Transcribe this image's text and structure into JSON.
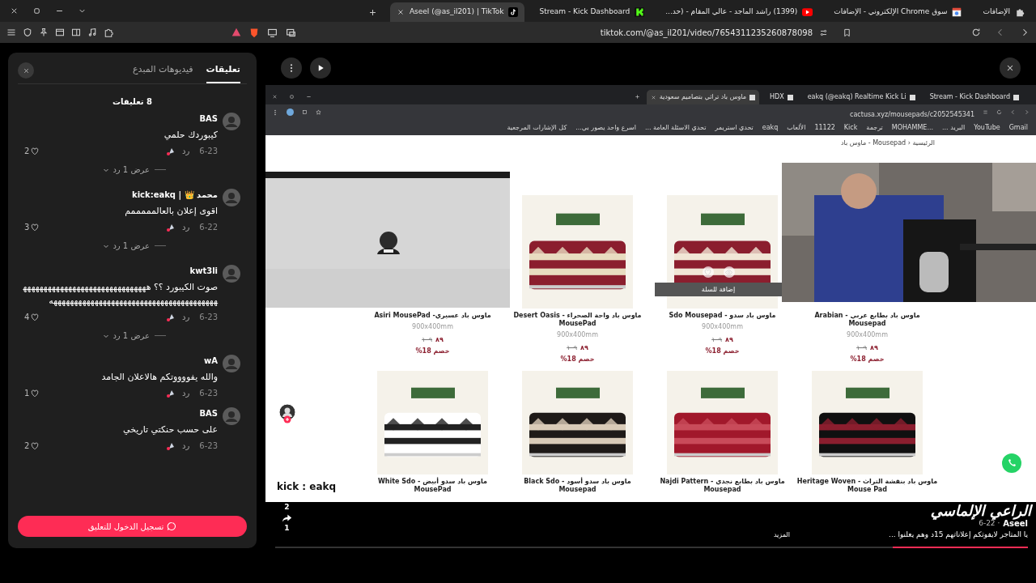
{
  "browser": {
    "tabs": [
      {
        "title": "الإضافات",
        "kind": "extensions",
        "selected": false
      },
      {
        "title": "سوق Chrome الإلكتروني - الإضافات",
        "kind": "store",
        "selected": false
      },
      {
        "title": "(1399) راشد الماجد - عالي المقام - (حد...",
        "kind": "youtube",
        "selected": false
      },
      {
        "title": "Stream - Kick Dashboard",
        "kind": "kick",
        "selected": false
      },
      {
        "title": "Aseel (@as_il201) | TikTok",
        "kind": "tiktok",
        "selected": true
      }
    ],
    "url": "tiktok.com/@as_il201/video/7654311235260878098"
  },
  "comments_panel": {
    "tabs": [
      {
        "label": "تعليقات",
        "selected": true
      },
      {
        "label": "فيديوهات المبدع",
        "selected": false
      }
    ],
    "count": "8 تعليقات",
    "comments": [
      {
        "user": "BAS",
        "text": "كيبوردك حلمي",
        "date": "6-23",
        "reply": "رد",
        "likes": "2",
        "view_replies": "عرض 1 رد"
      },
      {
        "user": "محمد 👑 | kick:eakq",
        "text": "اقوى إعلان بالعالمممممم",
        "date": "6-22",
        "reply": "رد",
        "likes": "3",
        "view_replies": "عرض 1 رد"
      },
      {
        "user": "kwt3li",
        "text": "صوت الكيبورد ؟؟ هههههههههههههههههههههههههههههههههههههههههههههههههههههههههههههههههههههههه",
        "date": "6-23",
        "reply": "رد",
        "likes": "4",
        "view_replies": "عرض 1 رد"
      },
      {
        "user": "wA",
        "text": "والله يفووووتكم هالاعلان الجامد",
        "date": "6-23",
        "reply": "رد",
        "likes": "1"
      },
      {
        "user": "BAS",
        "text": "على حسب حنكتي تاريخي",
        "date": "6-23",
        "reply": "رد",
        "likes": "2"
      }
    ],
    "login_button": "تسجيل الدخول للتعليق"
  },
  "video": {
    "inner_browser": {
      "tabs": [
        {
          "title": "Stream - Kick Dashboard",
          "selected": false
        },
        {
          "title": "eakq (@eakq) Realtime Kick Li",
          "selected": false
        },
        {
          "title": "HDX",
          "selected": false
        },
        {
          "title": "ماوس باد تراثي بتصاميم سعودية",
          "selected": true
        }
      ],
      "url": "cactusa.xyz/mousepads/c2052545341",
      "bookmarks": [
        "Gmail",
        "YouTube",
        "البريد ...",
        "MOHAMME...",
        "ترجمة",
        "Kick",
        "11122",
        "الألعاب",
        "eakq",
        "تحدي استريمر",
        "تحدي الاسئلة العامة ...",
        "اسرع واحد يصور بي...",
        "كل الإشارات المرجعية"
      ]
    },
    "breadcrumb": "الرئيسية ‹ Mousepad - ماوس باد",
    "products": [
      {
        "name": "ماوس باد بطابع عربي - Arabian Mousepad",
        "size": "900x400mm",
        "old_price": "١٠٩",
        "price": "٨٩",
        "discount": "خصم 18%",
        "image_covered": true
      },
      {
        "name": "ماوس باد سدو - Sdo Mousepad",
        "size": "900x400mm",
        "old_price": "١٠٩",
        "price": "٨٩",
        "discount": "خصم 18%",
        "hover_action": "إضافة للسلة"
      },
      {
        "name": "ماوس باد واحة الصحراء - Desert Oasis MousePad",
        "size": "900x400mm",
        "old_price": "١٠٩",
        "price": "٨٩",
        "discount": "خصم 18%"
      },
      {
        "name": "ماوس باد عسيري- Asiri MousePad",
        "size": "900x400mm",
        "old_price": "١٠٩",
        "price": "٨٩",
        "discount": "خصم 18%",
        "image_covered": true
      },
      {
        "name": "ماوس باد بنقشة التراث - Heritage Woven Mouse Pad"
      },
      {
        "name": "ماوس باد بطابع نجدي - Najdi Pattern Mousepad"
      },
      {
        "name": "ماوس باد سدو أسود - Black Sdo Mousepad"
      },
      {
        "name": "ماوس باد سدو أبيض - White Sdo MousePad"
      }
    ],
    "overlay_text": "kick : eakq",
    "likes": "2",
    "shares": "1",
    "caption_art": "الراعي الإلماسي",
    "author": "Aseel",
    "date": "6-22 ·",
    "description": "يا المتاجر لايفوتكم إعلاناتهم 15د  وهم يعلنوا ...",
    "more": "المزيد",
    "progress": {
      "level": 0.18
    }
  }
}
